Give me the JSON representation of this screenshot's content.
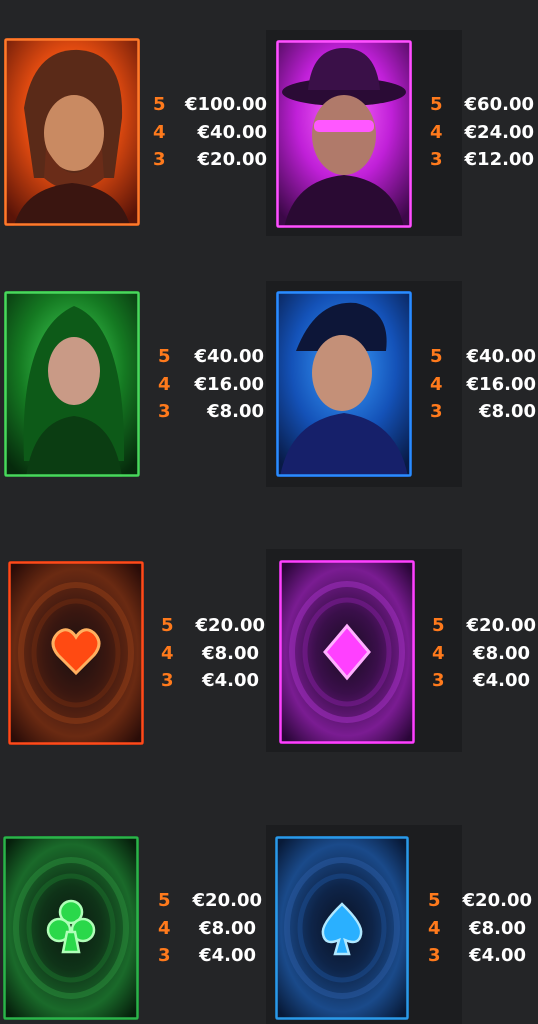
{
  "paytable": [
    {
      "symbol": "red-haired-man",
      "color": "#ff5a1f",
      "pays": [
        {
          "count": "5",
          "value": "€100.00"
        },
        {
          "count": "4",
          "value": "€40.00"
        },
        {
          "count": "3",
          "value": "€20.00"
        }
      ]
    },
    {
      "symbol": "purple-hat-man",
      "color": "#e040ff",
      "pays": [
        {
          "count": "5",
          "value": "€60.00"
        },
        {
          "count": "4",
          "value": "€24.00"
        },
        {
          "count": "3",
          "value": "€12.00"
        }
      ]
    },
    {
      "symbol": "green-haired-woman",
      "color": "#35d24a",
      "pays": [
        {
          "count": "5",
          "value": "€40.00"
        },
        {
          "count": "4",
          "value": "€16.00"
        },
        {
          "count": "3",
          "value": "€8.00"
        }
      ]
    },
    {
      "symbol": "blue-man",
      "color": "#2a8bff",
      "pays": [
        {
          "count": "5",
          "value": "€40.00"
        },
        {
          "count": "4",
          "value": "€16.00"
        },
        {
          "count": "3",
          "value": "€8.00"
        }
      ]
    },
    {
      "symbol": "heart",
      "color": "#ff5a1f",
      "pays": [
        {
          "count": "5",
          "value": "€20.00"
        },
        {
          "count": "4",
          "value": "€8.00"
        },
        {
          "count": "3",
          "value": "€4.00"
        }
      ]
    },
    {
      "symbol": "diamond",
      "color": "#e040ff",
      "pays": [
        {
          "count": "5",
          "value": "€20.00"
        },
        {
          "count": "4",
          "value": "€8.00"
        },
        {
          "count": "3",
          "value": "€4.00"
        }
      ]
    },
    {
      "symbol": "club",
      "color": "#35d24a",
      "pays": [
        {
          "count": "5",
          "value": "€20.00"
        },
        {
          "count": "4",
          "value": "€8.00"
        },
        {
          "count": "3",
          "value": "€4.00"
        }
      ]
    },
    {
      "symbol": "spade",
      "color": "#29a8ff",
      "pays": [
        {
          "count": "5",
          "value": "€20.00"
        },
        {
          "count": "4",
          "value": "€8.00"
        },
        {
          "count": "3",
          "value": "€4.00"
        }
      ]
    }
  ]
}
